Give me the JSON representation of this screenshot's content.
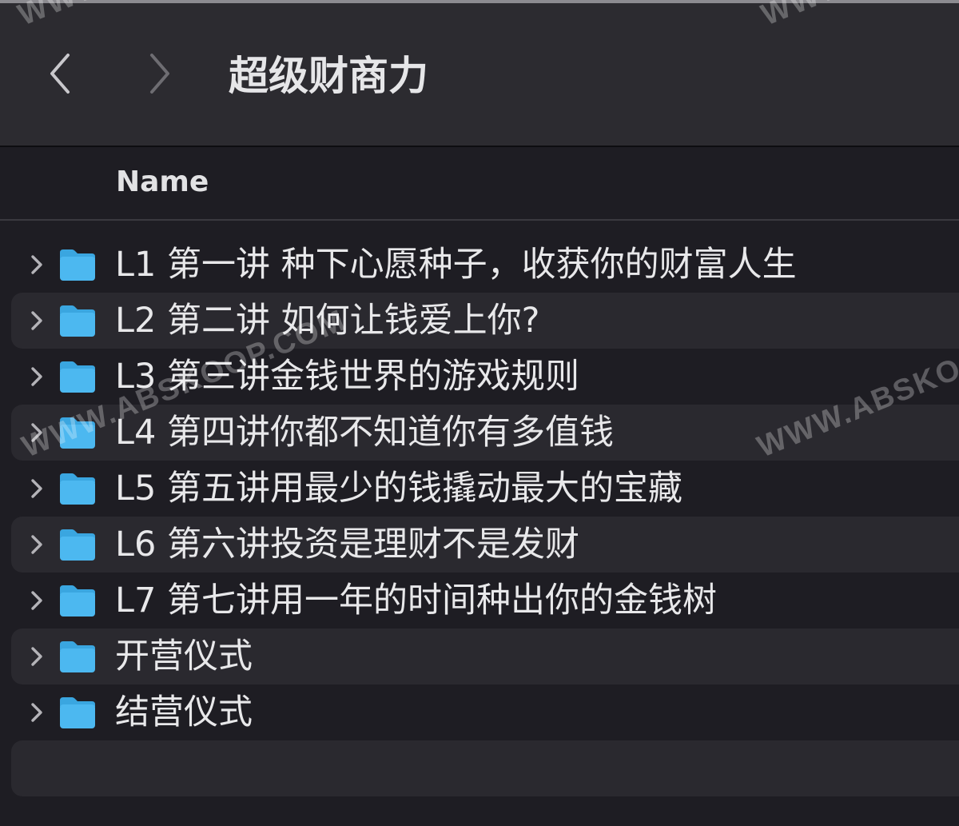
{
  "window": {
    "title": "超级财商力"
  },
  "toolbar": {
    "back_icon": "chevron-left-icon",
    "forward_icon": "chevron-right-icon"
  },
  "columns": {
    "name": "Name"
  },
  "files": [
    {
      "name": "L1 第一讲 种下心愿种子，收获你的财富人生",
      "type": "folder"
    },
    {
      "name": "L2 第二讲 如何让钱爱上你?",
      "type": "folder"
    },
    {
      "name": "L3 第三讲金钱世界的游戏规则",
      "type": "folder"
    },
    {
      "name": "L4 第四讲你都不知道你有多值钱",
      "type": "folder"
    },
    {
      "name": "L5 第五讲用最少的钱撬动最大的宝藏",
      "type": "folder"
    },
    {
      "name": "L6 第六讲投资是理财不是发财",
      "type": "folder"
    },
    {
      "name": "L7 第七讲用一年的时间种出你的金钱树",
      "type": "folder"
    },
    {
      "name": "开营仪式",
      "type": "folder"
    },
    {
      "name": "结营仪式",
      "type": "folder"
    }
  ],
  "watermarks": [
    {
      "text": "WWW.ABSKOOP.COM"
    },
    {
      "text": "WWW.ABSKOOP.COM"
    },
    {
      "text": "WWW"
    },
    {
      "text": "WWW"
    }
  ],
  "colors": {
    "folder": "#4cb8f0",
    "folder_tab": "#3aa6e0",
    "row_alt": "#2a292f",
    "background": "#1e1d23",
    "toolbar": "#2c2b30"
  }
}
